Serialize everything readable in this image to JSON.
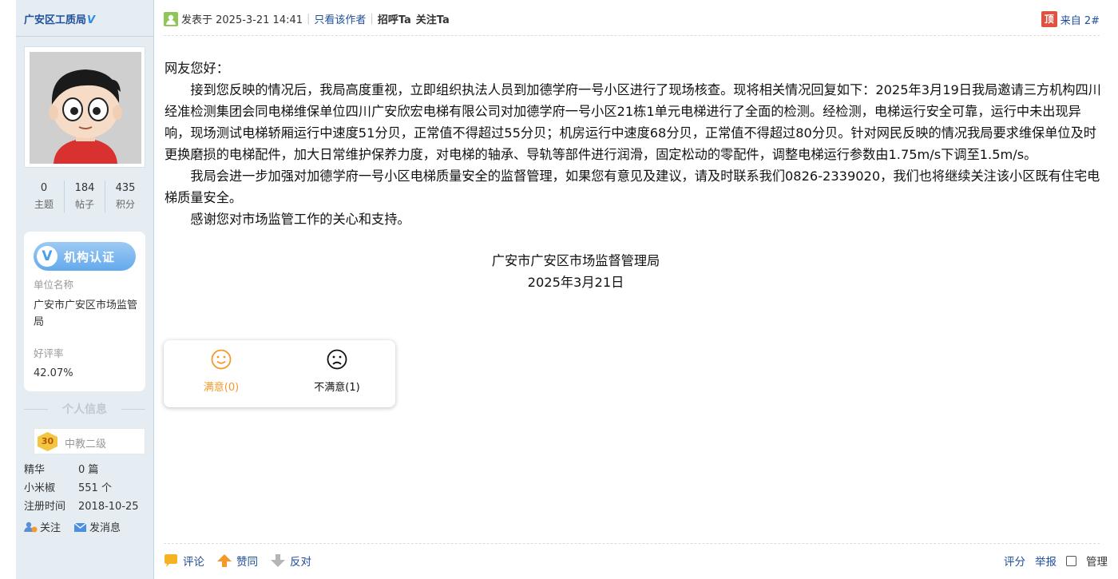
{
  "author": {
    "name": "广安区工质局",
    "verified_mark": "V",
    "stats": [
      {
        "value": "0",
        "label": "主题"
      },
      {
        "value": "184",
        "label": "帖子"
      },
      {
        "value": "435",
        "label": "积分"
      }
    ],
    "cert": {
      "badge": "机构认证",
      "org_label": "单位名称",
      "org_value": "广安市广安区市场监管局",
      "rating_label": "好评率",
      "rating_value": "42.07%"
    },
    "info_heading": "个人信息",
    "level": {
      "badge": "30",
      "name": "中教二级"
    },
    "details": [
      {
        "key": "精华",
        "value": "0 篇"
      },
      {
        "key": "小米椒",
        "value": "551 个"
      },
      {
        "key": "注册时间",
        "value": "2018-10-25"
      }
    ],
    "actions": {
      "follow": "关注",
      "message": "发消息"
    }
  },
  "post": {
    "posted_at": "发表于 2025-3-21 14:41",
    "only_author": "只看该作者",
    "greet": "招呼Ta",
    "follow": "关注Ta",
    "floor_tag": "顶",
    "floor": "来自 2#",
    "body": {
      "greeting": "网友您好：",
      "para1": "接到您反映的情况后，我局高度重视，立即组织执法人员到加德学府一号小区进行了现场核查。现将相关情况回复如下：2025年3月19日我局邀请三方机构四川经准检测集团会同电梯维保单位四川广安欣宏电梯有限公司对加德学府一号小区21栋1单元电梯进行了全面的检测。经检测，电梯运行安全可靠，运行中未出现异响，现场测试电梯轿厢运行中速度51分贝，正常值不得超过55分贝；机房运行中速度68分贝，正常值不得超过80分贝。针对网民反映的情况我局要求维保单位及时更换磨损的电梯配件，加大日常维护保养力度，对电梯的轴承、导轨等部件进行润滑，固定松动的零配件，调整电梯运行参数由1.75m/s下调至1.5m/s。",
      "para2": "我局会进一步加强对加德学府一号小区电梯质量安全的监督管理，如果您有意见及建议，请及时联系我们0826-2339020，我们也将继续关注该小区既有住宅电梯质量安全。",
      "para3": "感谢您对市场监管工作的关心和支持。",
      "signature": "广安市广安区市场监督管理局",
      "date": "2025年3月21日"
    },
    "rating": {
      "good": "满意(0)",
      "bad": "不满意(1)"
    },
    "footer": {
      "comment": "评论",
      "upvote": "赞同",
      "downvote": "反对",
      "rate": "评分",
      "report": "举报",
      "manage": "管理"
    }
  },
  "colors": {
    "link": "#1f4f9c",
    "sidebar_bg": "#e5edf2",
    "satisfied": "#f39a2b"
  }
}
